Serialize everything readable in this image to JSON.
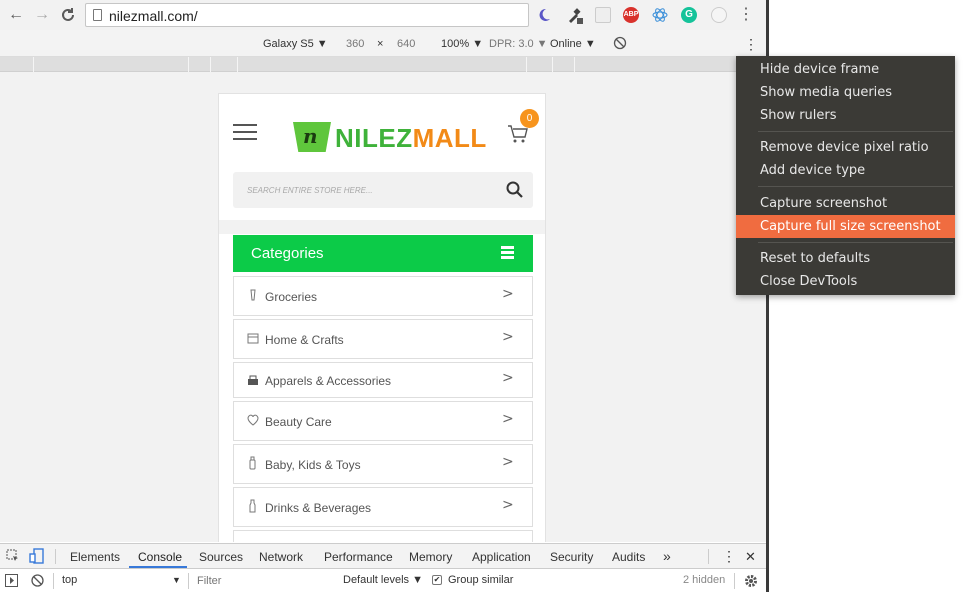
{
  "browser": {
    "url": "nilezmall.com/",
    "nav": {
      "back": "←",
      "forward": "→",
      "reload": "C"
    },
    "extensions": [
      "night-mode-icon",
      "eyedropper-icon",
      "ext-square-icon",
      "adblock-icon",
      "react-icon",
      "grammarly-icon",
      "ext-circle-icon"
    ],
    "adblock_label": "ABP",
    "grammarly_label": "G",
    "menu": "⋮"
  },
  "device_toolbar": {
    "device": "Galaxy S5 ▼",
    "width": "360",
    "times": "×",
    "height": "640",
    "zoom": "100% ▼",
    "dpr": "DPR: 3.0 ▼",
    "network": "Online ▼",
    "more": "⋮"
  },
  "site": {
    "logo_nilez": "NILEZ",
    "logo_mall": "MALL",
    "logo_bag_letter": "n",
    "cart_count": "0",
    "search_placeholder": "SEARCH ENTIRE STORE HERE...",
    "categories_title": "Categories",
    "categories": [
      {
        "label": "Groceries",
        "icon": "groceries-icon"
      },
      {
        "label": "Home & Crafts",
        "icon": "home-crafts-icon"
      },
      {
        "label": "Apparels & Accessories",
        "icon": "apparel-icon"
      },
      {
        "label": "Beauty Care",
        "icon": "beauty-icon"
      },
      {
        "label": "Baby, Kids & Toys",
        "icon": "baby-icon"
      },
      {
        "label": "Drinks & Beverages",
        "icon": "drinks-icon"
      }
    ],
    "chevron": ">"
  },
  "devtools": {
    "tabs": [
      "Elements",
      "Console",
      "Sources",
      "Network",
      "Performance",
      "Memory",
      "Application",
      "Security",
      "Audits"
    ],
    "active_tab": "Console",
    "more_tabs": "»",
    "menu": "⋮",
    "close": "✕",
    "context": "top",
    "context_arrow": "▼",
    "filter_placeholder": "Filter",
    "levels": "Default levels ▼",
    "group_similar": "Group similar",
    "hidden_count": "2 hidden"
  },
  "context_menu": {
    "items": [
      "Hide device frame",
      "Show media queries",
      "Show rulers",
      "Remove device pixel ratio",
      "Add device type",
      "Capture screenshot",
      "Capture full size screenshot",
      "Reset to defaults",
      "Close DevTools"
    ],
    "highlighted": "Capture full size screenshot",
    "highlight_color": "#f06c40"
  }
}
